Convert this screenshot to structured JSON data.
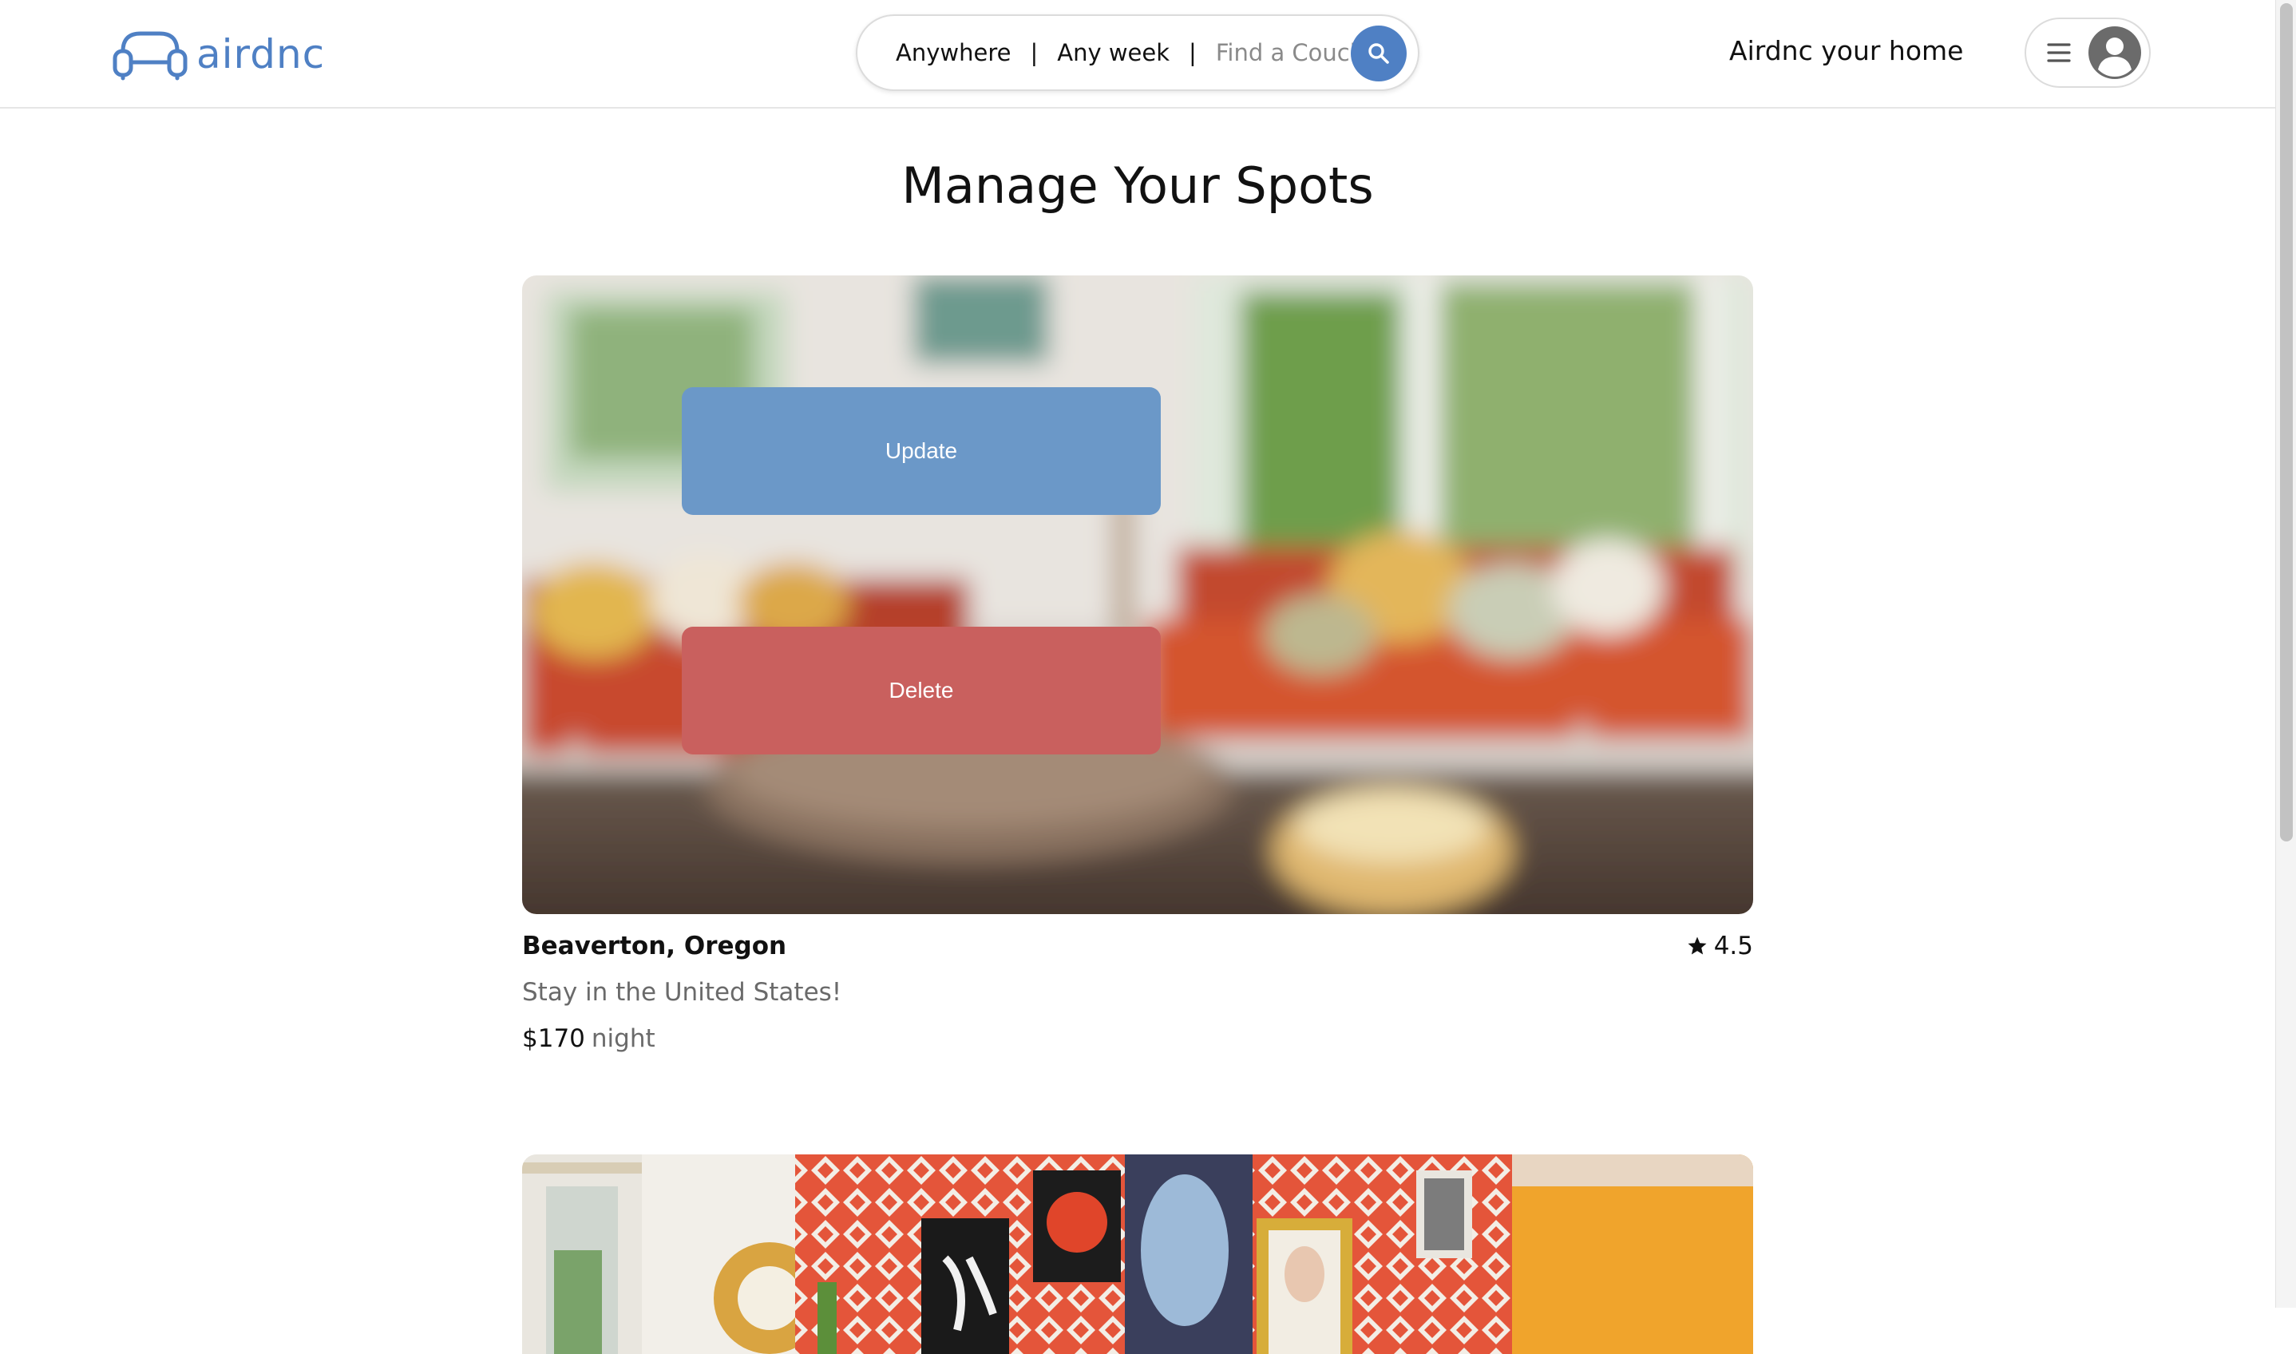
{
  "header": {
    "logo_text": "airdnc",
    "search": {
      "location_label": "Anywhere",
      "separator": "|",
      "week_label": "Any week",
      "placeholder": "Find a Couch"
    },
    "host_link": "Airdnc your home"
  },
  "main": {
    "title": "Manage Your Spots",
    "spots": [
      {
        "location": "Beaverton, Oregon",
        "rating": "4.5",
        "tagline": "Stay in the United States!",
        "price": "$170",
        "price_unit": "night",
        "update_label": "Update",
        "delete_label": "Delete"
      }
    ]
  },
  "colors": {
    "brand": "#4f80c4",
    "update_button": "#6b98c8",
    "delete_button": "#c9605e"
  },
  "icons": [
    "couch-logo-icon",
    "search-icon",
    "menu-icon",
    "avatar-icon",
    "star-icon"
  ]
}
